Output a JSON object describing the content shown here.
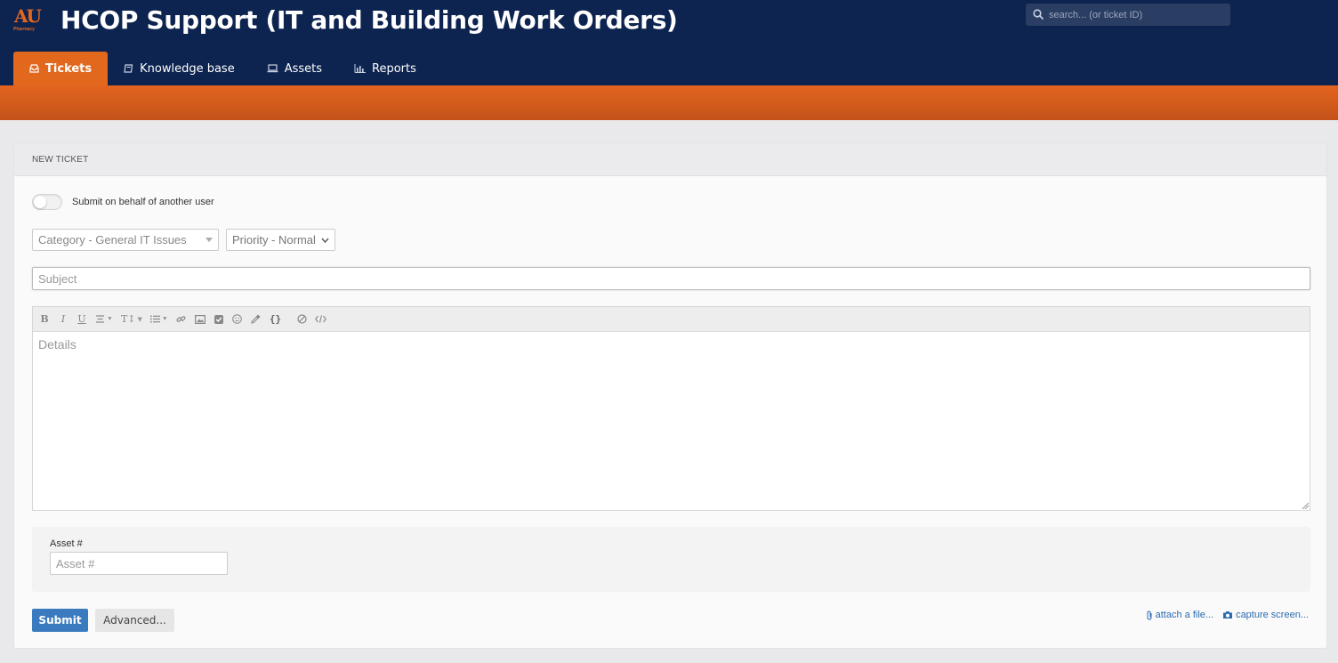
{
  "header": {
    "logo_text": "AU",
    "logo_subtext": "Pharmacy",
    "title": "HCOP Support (IT and Building Work Orders)",
    "search_placeholder": "search... (or ticket ID)"
  },
  "tabs": [
    {
      "label": "Tickets",
      "icon": "inbox-icon",
      "active": true
    },
    {
      "label": "Knowledge base",
      "icon": "book-icon",
      "active": false
    },
    {
      "label": "Assets",
      "icon": "laptop-icon",
      "active": false
    },
    {
      "label": "Reports",
      "icon": "bar-chart-icon",
      "active": false
    }
  ],
  "form": {
    "heading": "NEW TICKET",
    "on_behalf_label": "Submit on behalf of another user",
    "on_behalf_enabled": false,
    "category_value": "Category - General IT Issues",
    "priority_value": "Priority - Normal",
    "subject_placeholder": "Subject",
    "details_placeholder": "Details",
    "asset_label": "Asset #",
    "asset_placeholder": "Asset #",
    "submit_label": "Submit",
    "advanced_label": "Advanced...",
    "attach_label": "attach a file...",
    "capture_label": "capture screen..."
  },
  "toolbar": [
    "bold",
    "italic",
    "underline",
    "align",
    "font-size",
    "list",
    "link",
    "image",
    "checkbox",
    "emoji",
    "color-picker",
    "code-block",
    "clear-format",
    "source-code"
  ],
  "colors": {
    "header_bg": "#0d2450",
    "accent": "#e2681e",
    "primary_button": "#3a7bbf"
  }
}
